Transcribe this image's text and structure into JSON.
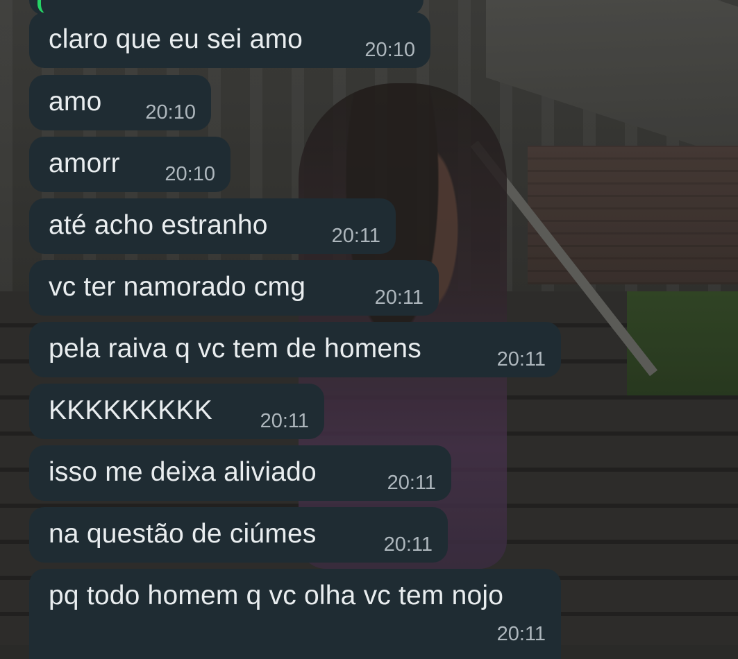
{
  "chat": {
    "messages": [
      {
        "text": "claro que eu sei amo",
        "time": "20:10"
      },
      {
        "text": "amo",
        "time": "20:10"
      },
      {
        "text": "amorr",
        "time": "20:10"
      },
      {
        "text": "até acho estranho",
        "time": "20:11"
      },
      {
        "text": "vc ter namorado cmg",
        "time": "20:11"
      },
      {
        "text": "pela raiva q vc tem de homens",
        "time": "20:11"
      },
      {
        "text": "KKKKKKKKK",
        "time": "20:11"
      },
      {
        "text": "isso me deixa aliviado",
        "time": "20:11"
      },
      {
        "text": "na questão de ciúmes",
        "time": "20:11"
      },
      {
        "text": "pq todo homem q vc olha vc tem nojo",
        "time": "20:11"
      }
    ]
  },
  "colors": {
    "incoming_bubble": "#1f2c33",
    "message_text": "#e9edef",
    "timestamp_text": "#aeb7bd",
    "accent_green": "#25d366"
  },
  "wallpaper": {
    "icon": "photo-wallpaper"
  }
}
